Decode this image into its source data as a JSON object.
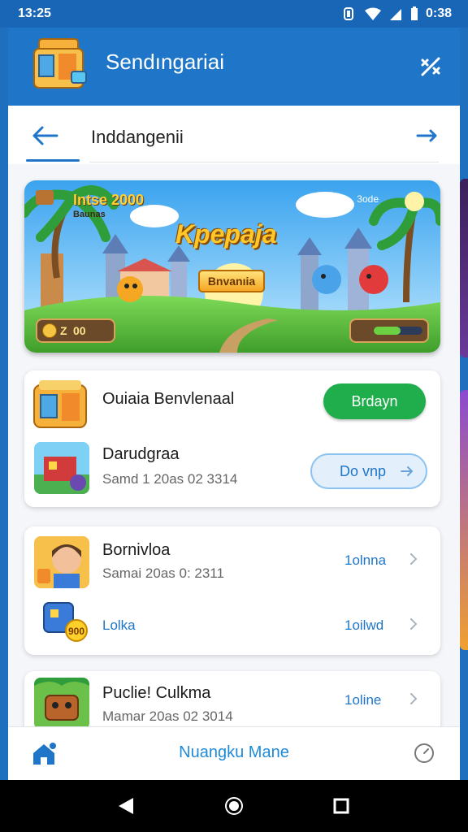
{
  "status_bar": {
    "time": "13:25",
    "right_time": "0:38"
  },
  "app_bar": {
    "title": "Sendıngariai",
    "action_icon": "percent-swap-icon"
  },
  "sub_nav": {
    "title": "Inddangenii"
  },
  "banner": {
    "tag": "Intse 2000",
    "tag_sub": "Baunas",
    "corner_text": "3ode",
    "title": "Kpepaja",
    "button_label": "Bnvanıia",
    "score_left": "Z",
    "score_value": "00",
    "meter_level": 0.55
  },
  "card1": {
    "rows": [
      {
        "title": "Ouiaia Benvlenaal",
        "button": "Brdayn"
      },
      {
        "title": "Darudgraa",
        "subtitle": "Samd 1 20as 02 3314",
        "button": "Do vnp"
      }
    ]
  },
  "card2": {
    "rows": [
      {
        "title": "Bornivloa",
        "subtitle": "Samai 20as 0: 2311",
        "link": "1olnna"
      },
      {
        "title": "Lolka",
        "badge": "900",
        "link": "1oilwd"
      }
    ]
  },
  "card3": {
    "rows": [
      {
        "title": "Puclie! Culkma",
        "subtitle": "Mamar 20as 02 3014",
        "link": "1oline"
      }
    ]
  },
  "bottom_nav": {
    "label": "Nuangku Mane"
  },
  "colors": {
    "primary": "#1f76c9",
    "green": "#1fae4b",
    "sheet": "#f4f6f9"
  }
}
